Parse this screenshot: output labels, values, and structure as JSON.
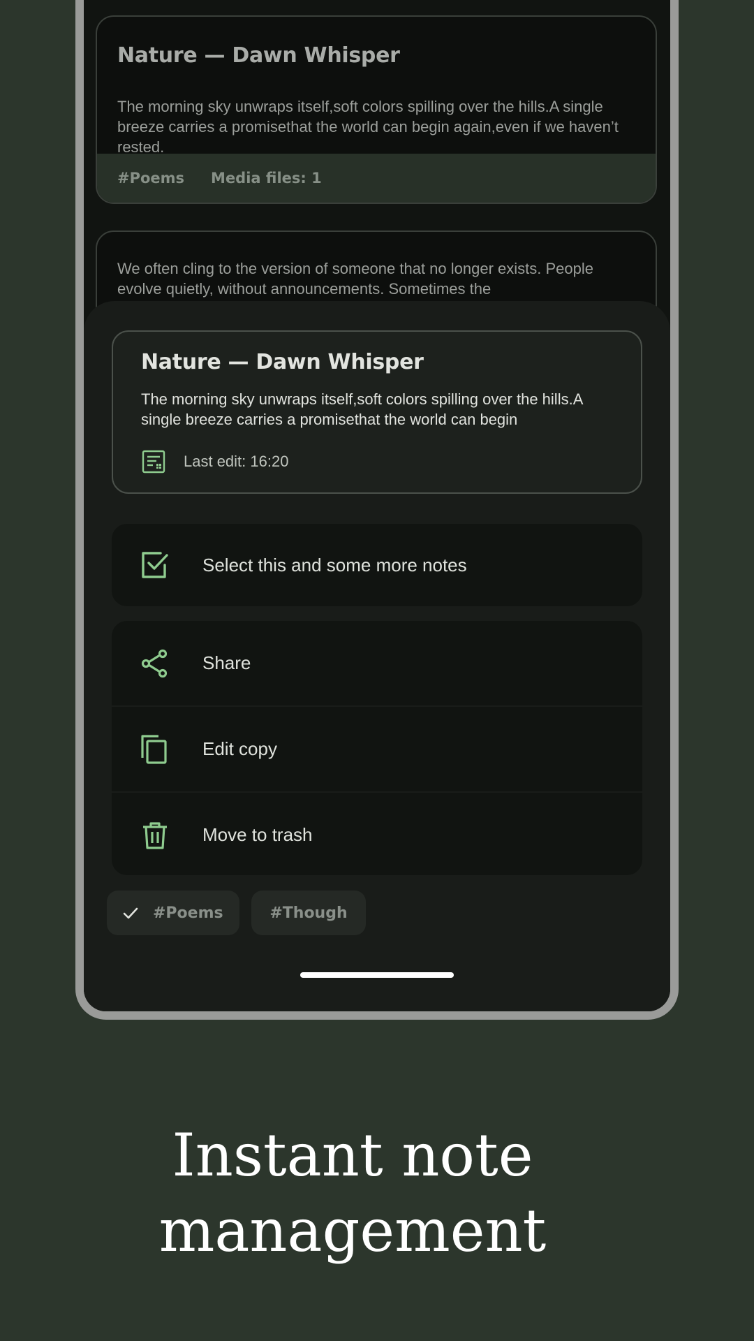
{
  "list": {
    "cards": [
      {
        "title": "Nature — Dawn Whisper",
        "body": "The morning sky unwraps itself,soft colors spilling over the hills.A single breeze carries a promisethat the world can begin again,even if we haven’t rested.",
        "tag": "#Poems",
        "media": "Media files: 1"
      },
      {
        "body": "We often cling to the version of someone that no longer exists. People evolve quietly, without announcements. Sometimes the"
      }
    ]
  },
  "sheet": {
    "preview": {
      "title": "Nature — Dawn Whisper",
      "body": "The morning sky unwraps itself,soft colors spilling over the hills.A single breeze carries a promisethat the world can begin",
      "meta_icon": "note-details-icon",
      "last_edit": "Last edit: 16:20"
    },
    "actions": {
      "select": {
        "label": "Select this and some more notes",
        "icon": "checkbox-icon"
      },
      "share": {
        "label": "Share",
        "icon": "share-icon"
      },
      "edit_copy": {
        "label": "Edit copy",
        "icon": "copy-icon"
      },
      "trash": {
        "label": "Move to trash",
        "icon": "trash-icon"
      }
    },
    "tags": [
      {
        "label": "#Poems",
        "selected": true
      },
      {
        "label": "#Though",
        "selected": false
      }
    ]
  },
  "colors": {
    "accent": "#8fcc8f",
    "background": "#2c362c",
    "sheet": "#191c19"
  },
  "caption": {
    "line1": "Instant note",
    "line2": "management"
  }
}
